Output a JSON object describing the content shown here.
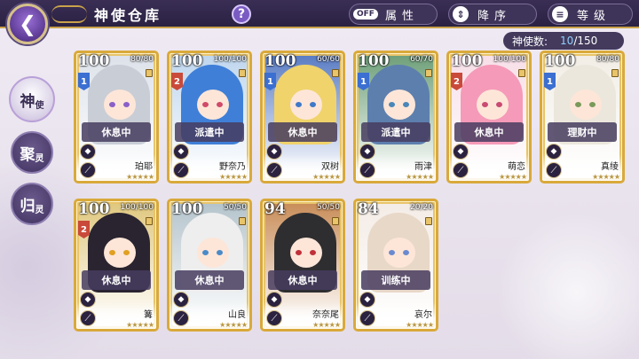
{
  "header": {
    "back_icon": "back-arrow-icon",
    "title": "神使仓库",
    "help_label": "?"
  },
  "controls": {
    "attribute": {
      "toggle": "OFF",
      "label": "属性"
    },
    "order": {
      "icon": "⇕",
      "label": "降序"
    },
    "sort": {
      "icon": "≡",
      "label": "等级"
    }
  },
  "count": {
    "label": "神使数:",
    "current": "10",
    "max": "/150"
  },
  "sidebar": {
    "tabs": [
      {
        "big": "神",
        "small": "使",
        "active": true
      },
      {
        "big": "聚",
        "small": "灵",
        "active": false
      },
      {
        "big": "归",
        "small": "灵",
        "active": false
      }
    ]
  },
  "cards": [
    {
      "level": "100",
      "affinity": "80/80",
      "rank": "1",
      "status": "休息中",
      "name": "珀耶",
      "hair": "#c9cdd6",
      "eye": "#8a60c8",
      "bg": "#dde2ea",
      "rankColor": "#3b6fd1"
    },
    {
      "level": "100",
      "affinity": "100/100",
      "rank": "2",
      "status": "派遣中",
      "name": "野奈乃",
      "hair": "#3f7fd8",
      "eye": "#d04a6a",
      "bg": "#bfd6ee",
      "rankColor": "#c94a3a"
    },
    {
      "level": "100",
      "affinity": "60/60",
      "rank": "1",
      "status": "休息中",
      "name": "双树",
      "hair": "#f0d36b",
      "eye": "#3f79c8",
      "bg": "#5b7dc4",
      "rankColor": "#3b6fd1"
    },
    {
      "level": "100",
      "affinity": "60/70",
      "rank": "1",
      "status": "派遣中",
      "name": "雨津",
      "hair": "#5d7fae",
      "eye": "#4a86b8",
      "bg": "#6fa07a",
      "rankColor": "#3b6fd1"
    },
    {
      "level": "100",
      "affinity": "100/100",
      "rank": "2",
      "status": "休息中",
      "name": "萌恋",
      "hair": "#f59ab8",
      "eye": "#c94a72",
      "bg": "#f7dfe8",
      "rankColor": "#c94a3a"
    },
    {
      "level": "100",
      "affinity": "80/80",
      "rank": "1",
      "status": "理财中",
      "name": "真绫",
      "hair": "#ece7dc",
      "eye": "#7a9a5a",
      "bg": "#f2eee6",
      "rankColor": "#3b6fd1"
    },
    {
      "level": "100",
      "affinity": "100/100",
      "rank": "2",
      "status": "休息中",
      "name": "篝",
      "hair": "#2a2430",
      "eye": "#e0a020",
      "bg": "#e0c880",
      "rankColor": "#c94a3a"
    },
    {
      "level": "100",
      "affinity": "50/50",
      "rank": "",
      "status": "休息中",
      "name": "山良",
      "hair": "#eeeeee",
      "eye": "#4a8ac8",
      "bg": "#b5c4cc",
      "rankColor": "#3b6fd1"
    },
    {
      "level": "94",
      "affinity": "50/50",
      "rank": "",
      "status": "休息中",
      "name": "奈奈尾",
      "hair": "#2e2e30",
      "eye": "#c0303a",
      "bg": "#c98e5a",
      "rankColor": "#3b6fd1"
    },
    {
      "level": "84",
      "affinity": "20/20",
      "rank": "",
      "status": "训练中",
      "name": "哀尔",
      "hair": "#e8d8c8",
      "eye": "#6a8ad0",
      "bg": "#f4ece6",
      "rankColor": "#3b6fd1"
    }
  ]
}
